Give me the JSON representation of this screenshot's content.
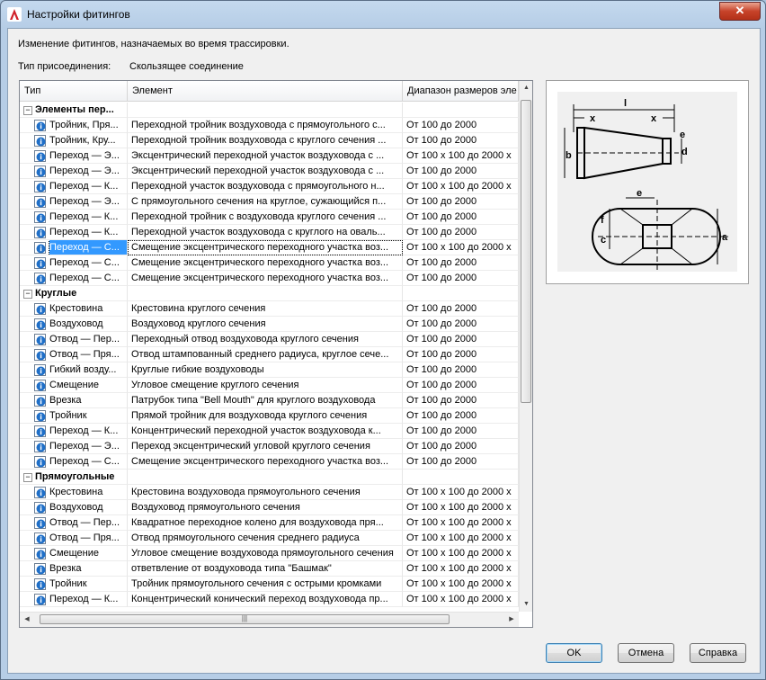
{
  "window": {
    "title": "Настройки фитингов"
  },
  "description": "Изменение фитингов, назначаемых во время трассировки.",
  "connection": {
    "label": "Тип присоединения:",
    "value": "Скользящее соединение"
  },
  "columns": {
    "type": "Тип",
    "element": "Элемент",
    "range": "Диапазон размеров эле"
  },
  "rows": [
    {
      "kind": "group",
      "label": "Элементы пер..."
    },
    {
      "kind": "item",
      "type": "Тройник, Пря...",
      "element": "Переходной тройник воздуховода с прямоугольного с...",
      "range": "От 100 до 2000"
    },
    {
      "kind": "item",
      "type": "Тройник, Кру...",
      "element": "Переходной тройник воздуховода с круглого сечения ...",
      "range": "От 100 до 2000"
    },
    {
      "kind": "item",
      "type": "Переход — Э...",
      "element": "Эксцентрический переходной участок воздуховода с ...",
      "range": "От 100 x 100 до 2000 x"
    },
    {
      "kind": "item",
      "type": "Переход — Э...",
      "element": "Эксцентрический переходной участок воздуховода с ...",
      "range": "От 100 до 2000"
    },
    {
      "kind": "item",
      "type": "Переход — К...",
      "element": "Переходной участок воздуховода с прямоугольного н...",
      "range": "От 100 x 100 до 2000 x"
    },
    {
      "kind": "item",
      "type": "Переход — Э...",
      "element": "С прямоугольного сечения на круглое, сужающийся п...",
      "range": "От 100 до 2000"
    },
    {
      "kind": "item",
      "type": "Переход — К...",
      "element": "Переходной тройник с воздуховода круглого сечения ...",
      "range": "От 100 до 2000"
    },
    {
      "kind": "item",
      "type": "Переход — К...",
      "element": "Переходной участок воздуховода с круглого на оваль...",
      "range": "От 100 до 2000"
    },
    {
      "kind": "item",
      "type": "Переход — С...",
      "element": "Смещение эксцентрического переходного участка воз...",
      "range": "От 100 x 100 до 2000 x",
      "selected": true
    },
    {
      "kind": "item",
      "type": "Переход — С...",
      "element": "Смещение эксцентрического переходного участка воз...",
      "range": "От 100 до 2000"
    },
    {
      "kind": "item",
      "type": "Переход — С...",
      "element": "Смещение эксцентрического переходного участка воз...",
      "range": "От 100 до 2000"
    },
    {
      "kind": "group",
      "label": "Круглые"
    },
    {
      "kind": "item",
      "type": "Крестовина",
      "element": "Крестовина круглого сечения",
      "range": "От 100 до 2000"
    },
    {
      "kind": "item",
      "type": "Воздуховод",
      "element": "Воздуховод круглого сечения",
      "range": "От 100 до 2000"
    },
    {
      "kind": "item",
      "type": "Отвод — Пер...",
      "element": "Переходный отвод воздуховода круглого сечения",
      "range": "От 100 до 2000"
    },
    {
      "kind": "item",
      "type": "Отвод — Пря...",
      "element": "Отвод штампованный среднего радиуса, круглое сече...",
      "range": "От 100 до 2000"
    },
    {
      "kind": "item",
      "type": "Гибкий возду...",
      "element": "Круглые гибкие воздуховоды",
      "range": "От 100 до 2000"
    },
    {
      "kind": "item",
      "type": "Смещение",
      "element": "Угловое смещение круглого сечения",
      "range": "От 100 до 2000"
    },
    {
      "kind": "item",
      "type": "Врезка",
      "element": "Патрубок типа \"Bell Mouth\" для круглого воздуховода",
      "range": "От 100 до 2000"
    },
    {
      "kind": "item",
      "type": "Тройник",
      "element": "Прямой тройник для воздуховода круглого сечения",
      "range": "От 100 до 2000"
    },
    {
      "kind": "item",
      "type": "Переход — К...",
      "element": "Концентрический переходной участок воздуховода к...",
      "range": "От 100 до 2000"
    },
    {
      "kind": "item",
      "type": "Переход — Э...",
      "element": "Переход эксцентрический угловой круглого сечения",
      "range": "От 100 до 2000"
    },
    {
      "kind": "item",
      "type": "Переход — С...",
      "element": "Смещение эксцентрического переходного участка воз...",
      "range": "От 100 до 2000"
    },
    {
      "kind": "group",
      "label": "Прямоугольные"
    },
    {
      "kind": "item",
      "type": "Крестовина",
      "element": "Крестовина воздуховода прямоугольного сечения",
      "range": "От 100 x 100 до 2000 x"
    },
    {
      "kind": "item",
      "type": "Воздуховод",
      "element": "Воздуховод прямоугольного сечения",
      "range": "От 100 x 100 до 2000 x"
    },
    {
      "kind": "item",
      "type": "Отвод — Пер...",
      "element": "Квадратное переходное колено для воздуховода пря...",
      "range": "От 100 x 100 до 2000 x"
    },
    {
      "kind": "item",
      "type": "Отвод — Пря...",
      "element": "Отвод прямоугольного сечения среднего радиуса",
      "range": "От 100 x 100 до 2000 x"
    },
    {
      "kind": "item",
      "type": "Смещение",
      "element": "Угловое смещение воздуховода прямоугольного сечения",
      "range": "От 100 x 100 до 2000 x"
    },
    {
      "kind": "item",
      "type": "Врезка",
      "element": "ответвление от воздуховода типа \"Башмак\"",
      "range": "От 100 x 100 до 2000 x"
    },
    {
      "kind": "item",
      "type": "Тройник",
      "element": "Тройник прямоугольного сечения с острыми кромками",
      "range": "От 100 x 100 до 2000 x"
    },
    {
      "kind": "item",
      "type": "Переход — К...",
      "element": "Концентрический конический переход воздуховода пр...",
      "range": "От 100 x 100 до 2000 x"
    }
  ],
  "diagram_labels": {
    "l": "l",
    "x": "x",
    "b": "b",
    "d": "d",
    "e": "e",
    "f": "f",
    "c": "c",
    "a": "a"
  },
  "buttons": {
    "ok": "OK",
    "cancel": "Отмена",
    "help": "Справка"
  },
  "colors": {
    "selection": "#3399ff",
    "info_icon": "#1f6fc8",
    "close": "#c7432a"
  }
}
